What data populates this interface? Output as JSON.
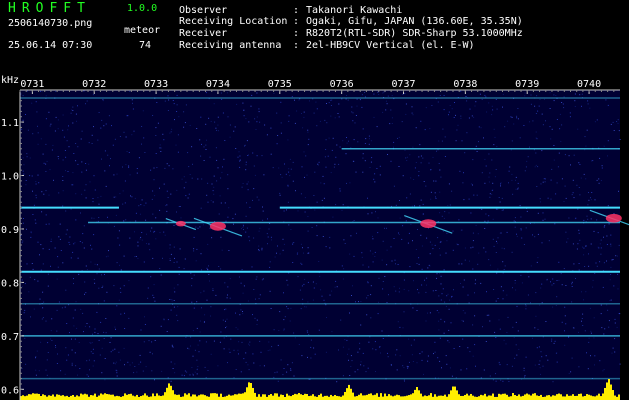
{
  "app": {
    "title": "HROFFT",
    "version": "1.0.0"
  },
  "file": {
    "name": "2506140730.png",
    "timestamp": "25.06.14 07:30"
  },
  "counter": {
    "label": "meteor",
    "value": "74"
  },
  "info": [
    {
      "label": "Observer",
      "value": "Takanori Kawachi"
    },
    {
      "label": "Receiving Location",
      "value": "Ogaki, Gifu, JAPAN (136.60E, 35.35N)"
    },
    {
      "label": "Receiver",
      "value": "R820T2(RTL-SDR) SDR-Sharp 53.1000MHz"
    },
    {
      "label": "Receiving antenna",
      "value": "2el-HB9CV Vertical (el. E-W)"
    }
  ],
  "colors": {
    "title": "#22ff22",
    "background": "#000033",
    "trace": "#44ddff",
    "meteor": "#ff3366",
    "level": "#ffee00"
  },
  "chart_data": {
    "type": "heatmap",
    "ylabel": "kHz",
    "x_ticks": [
      "0731",
      "0732",
      "0733",
      "0734",
      "0735",
      "0736",
      "0737",
      "0738",
      "0739",
      "0740"
    ],
    "y_ticks": [
      "1.1",
      "1.0",
      "0.9",
      "0.8",
      "0.7",
      "0.6"
    ],
    "ylim": [
      0.58,
      1.16
    ],
    "xlim": [
      730.8,
      740.5
    ],
    "carriers": [
      {
        "freq": 0.94,
        "x_start": 730.8,
        "x_end": 732.4,
        "intensity": "high"
      },
      {
        "freq": 0.94,
        "x_start": 735.0,
        "x_end": 740.5,
        "intensity": "high"
      },
      {
        "freq": 0.912,
        "x_start": 731.9,
        "x_end": 740.5,
        "intensity": "medium"
      },
      {
        "freq": 0.82,
        "x_start": 730.8,
        "x_end": 740.5,
        "intensity": "high"
      },
      {
        "freq": 1.05,
        "x_start": 736.0,
        "x_end": 740.5,
        "intensity": "medium"
      },
      {
        "freq": 1.145,
        "x_start": 730.8,
        "x_end": 740.5,
        "intensity": "low"
      },
      {
        "freq": 0.76,
        "x_start": 730.8,
        "x_end": 740.5,
        "intensity": "low"
      },
      {
        "freq": 0.7,
        "x_start": 730.8,
        "x_end": 740.5,
        "intensity": "medium"
      },
      {
        "freq": 0.62,
        "x_start": 730.8,
        "x_end": 740.5,
        "intensity": "low"
      }
    ],
    "meteor_echoes": [
      {
        "time": 733.4,
        "freq": 0.91,
        "strength": "medium"
      },
      {
        "time": 734.0,
        "freq": 0.905,
        "strength": "strong"
      },
      {
        "time": 737.4,
        "freq": 0.91,
        "strength": "strong"
      },
      {
        "time": 740.4,
        "freq": 0.92,
        "strength": "strong"
      }
    ],
    "level_peaks": [
      {
        "time": 733.2,
        "level": 0.8
      },
      {
        "time": 734.5,
        "level": 0.9
      },
      {
        "time": 736.1,
        "level": 0.7
      },
      {
        "time": 737.2,
        "level": 0.6
      },
      {
        "time": 737.8,
        "level": 0.7
      },
      {
        "time": 740.3,
        "level": 1.0
      }
    ]
  }
}
